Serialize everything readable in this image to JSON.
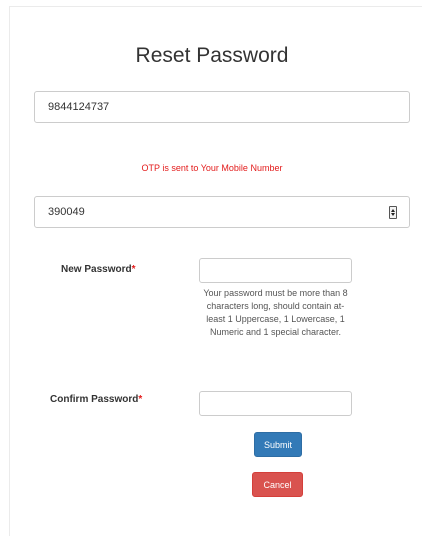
{
  "page": {
    "title": "Reset Password"
  },
  "mobile": {
    "value": "9844124737"
  },
  "otp": {
    "message": "OTP is sent to Your Mobile Number",
    "value": "390049"
  },
  "new_password": {
    "label": "New Password",
    "required_mark": "*",
    "value": "",
    "help": "Your password must be more than 8 characters long, should contain at-least 1 Uppercase, 1 Lowercase, 1 Numeric and 1 special character."
  },
  "confirm_password": {
    "label": "Confirm Password",
    "required_mark": "*",
    "value": ""
  },
  "buttons": {
    "submit": "Submit",
    "cancel": "Cancel"
  },
  "colors": {
    "primary": "#337ab7",
    "danger": "#d9534f",
    "error_text": "#e31b1b"
  }
}
